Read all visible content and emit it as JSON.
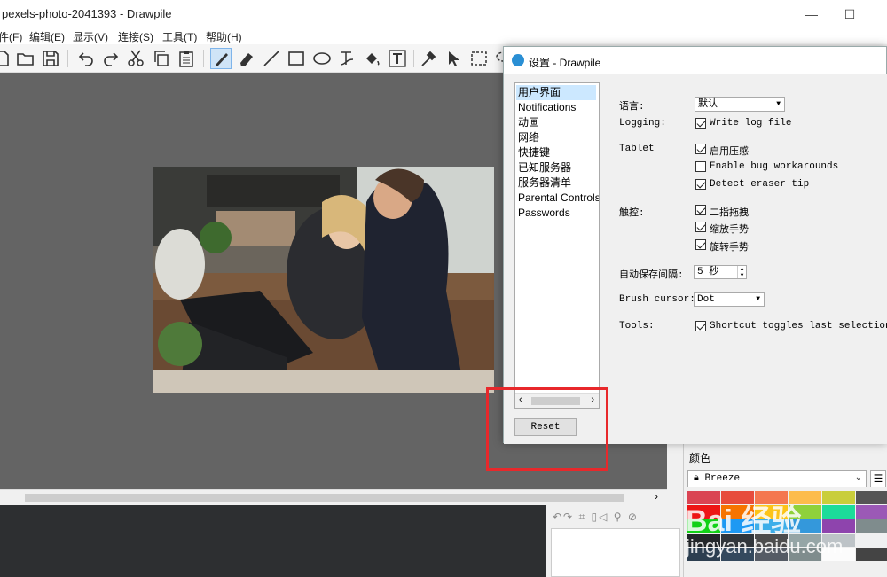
{
  "window": {
    "title": "pexels-photo-2041393 - Drawpile"
  },
  "menu": [
    "件(F)",
    "编辑(E)",
    "显示(V)",
    "连接(S)",
    "工具(T)",
    "帮助(H)"
  ],
  "toolbar_icons": [
    "new-icon",
    "open-icon",
    "save-icon",
    "undo-icon",
    "redo-icon",
    "cut-icon",
    "copy-icon",
    "paste-icon",
    "brush-icon",
    "eraser-icon",
    "line-icon",
    "rect-icon",
    "ellipse-icon",
    "bezier-icon",
    "fill-icon",
    "text-icon",
    "picker-icon",
    "move-icon",
    "select-icon",
    "lasso-icon"
  ],
  "dialog": {
    "title": "设置 - Drawpile",
    "categories": [
      "用户界面",
      "Notifications",
      "动画",
      "网络",
      "快捷键",
      "已知服务器",
      "服务器清单",
      "Parental Controls",
      "Passwords"
    ],
    "selected_category": "用户界面",
    "reset_label": "Reset",
    "language": {
      "label": "语言:",
      "value": "默认"
    },
    "logging": {
      "label": "Logging:",
      "option": "Write log file",
      "checked": true
    },
    "tablet": {
      "label": "Tablet",
      "options": [
        {
          "text": "启用压感",
          "checked": true
        },
        {
          "text": "Enable bug workarounds",
          "checked": false
        },
        {
          "text": "Detect eraser tip",
          "checked": true
        }
      ]
    },
    "touch": {
      "label": "触控:",
      "options": [
        {
          "text": "二指拖拽",
          "checked": true
        },
        {
          "text": "缩放手势",
          "checked": true
        },
        {
          "text": "旋转手势",
          "checked": true
        }
      ]
    },
    "autosave": {
      "label": "自动保存间隔:",
      "value": "5 秒"
    },
    "brush_cursor": {
      "label": "Brush cursor:",
      "value": "Dot"
    },
    "tools": {
      "label": "Tools:",
      "option": "Shortcut toggles last selection",
      "checked": true
    }
  },
  "color_panel": {
    "header": "颜色",
    "palette": "Breeze",
    "swatches": [
      "#da4453",
      "#e74c3c",
      "#f47750",
      "#fdbc4b",
      "#c9ce3b",
      "#555555",
      "#ed1515",
      "#f67400",
      "#fcc419",
      "#8fd13b",
      "#1cdc9a",
      "#9b59b6",
      "#11d116",
      "#1d99f3",
      "#3daee9",
      "#3498db",
      "#8e44ad",
      "#7f8c8d",
      "#232629",
      "#31363b",
      "#4d4d4d",
      "#95a5a6",
      "#bdc3c7",
      "#eff0f1",
      "#2c3e50",
      "#34495e",
      "#555b65",
      "#7f8c8d",
      "#fcfcfc",
      "#444444"
    ]
  },
  "watermark": {
    "logo": "Bai 经验",
    "url": "jingyan.baidu.com"
  },
  "highlight_color": "#e8282b"
}
